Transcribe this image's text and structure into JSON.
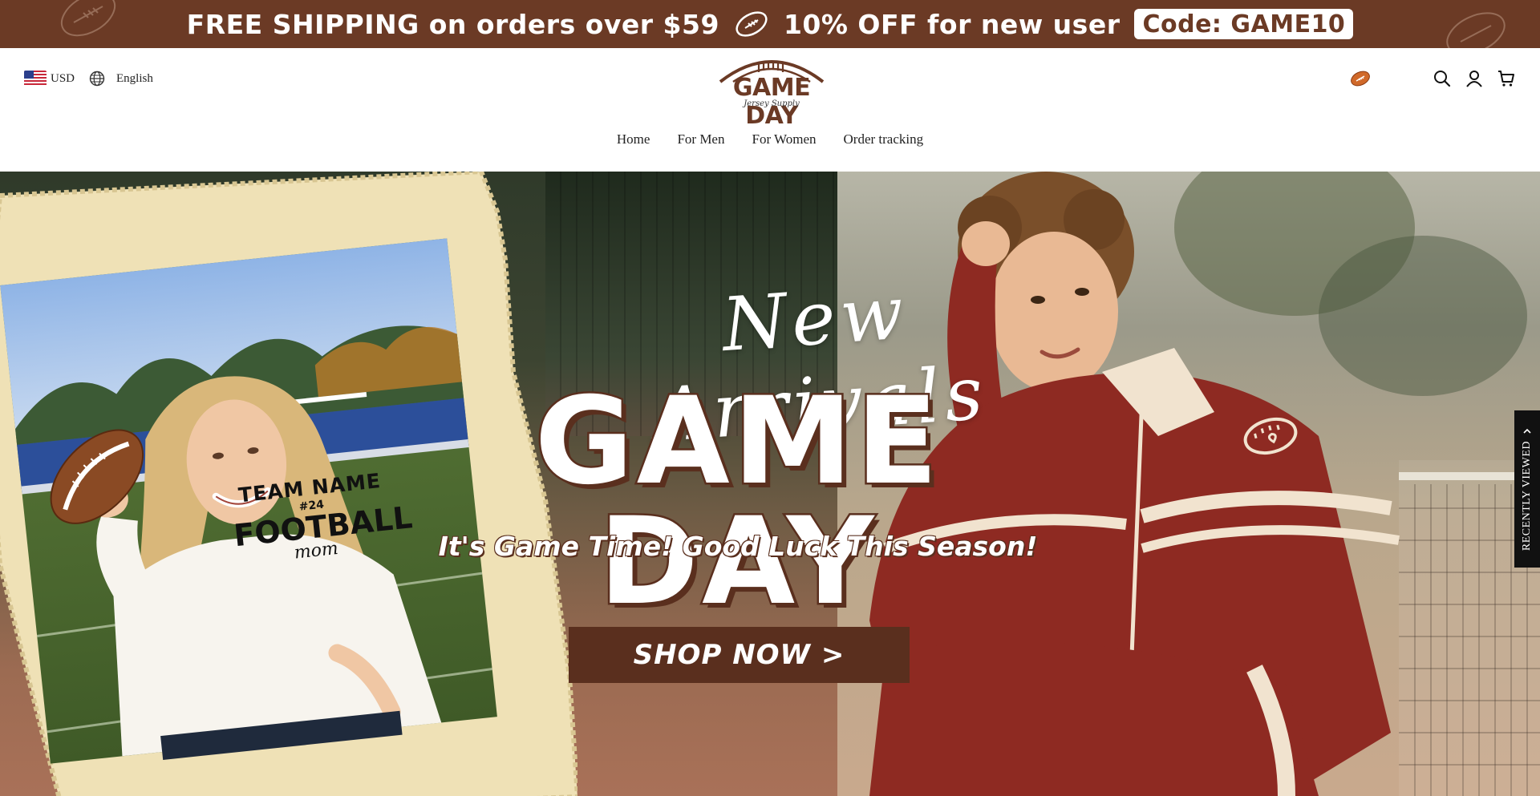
{
  "announcement": {
    "shipping_text": "FREE SHIPPING on orders over $59",
    "discount_text": "10% OFF for new user",
    "code_text": "Code: GAME10"
  },
  "header": {
    "currency": "USD",
    "language": "English",
    "logo": {
      "title": "GAME DAY",
      "subtitle": "Jersey Supply"
    }
  },
  "nav": {
    "items": [
      {
        "label": "Home"
      },
      {
        "label": "For Men"
      },
      {
        "label": "For Women"
      },
      {
        "label": "Order tracking"
      }
    ]
  },
  "hero": {
    "script_text": "New Arrivals",
    "title": "GAME DAY",
    "subtitle": "It's Game Time! Good Luck This Season!",
    "cta_label": "SHOP NOW >",
    "sweatshirt": {
      "line1": "TEAM NAME",
      "line2": "#24",
      "line3": "FOOTBALL",
      "line4": "mom"
    }
  },
  "recently_viewed": {
    "label": "RECENTLY VIEWED"
  },
  "colors": {
    "brand_brown": "#6b3a25",
    "button_brown": "#5a2f1e",
    "jacket_red": "#8e2a22"
  },
  "icons": {
    "search": "search-icon",
    "account": "account-icon",
    "cart": "cart-icon",
    "football": "football-icon",
    "globe": "globe-icon",
    "flag": "us-flag-icon"
  }
}
